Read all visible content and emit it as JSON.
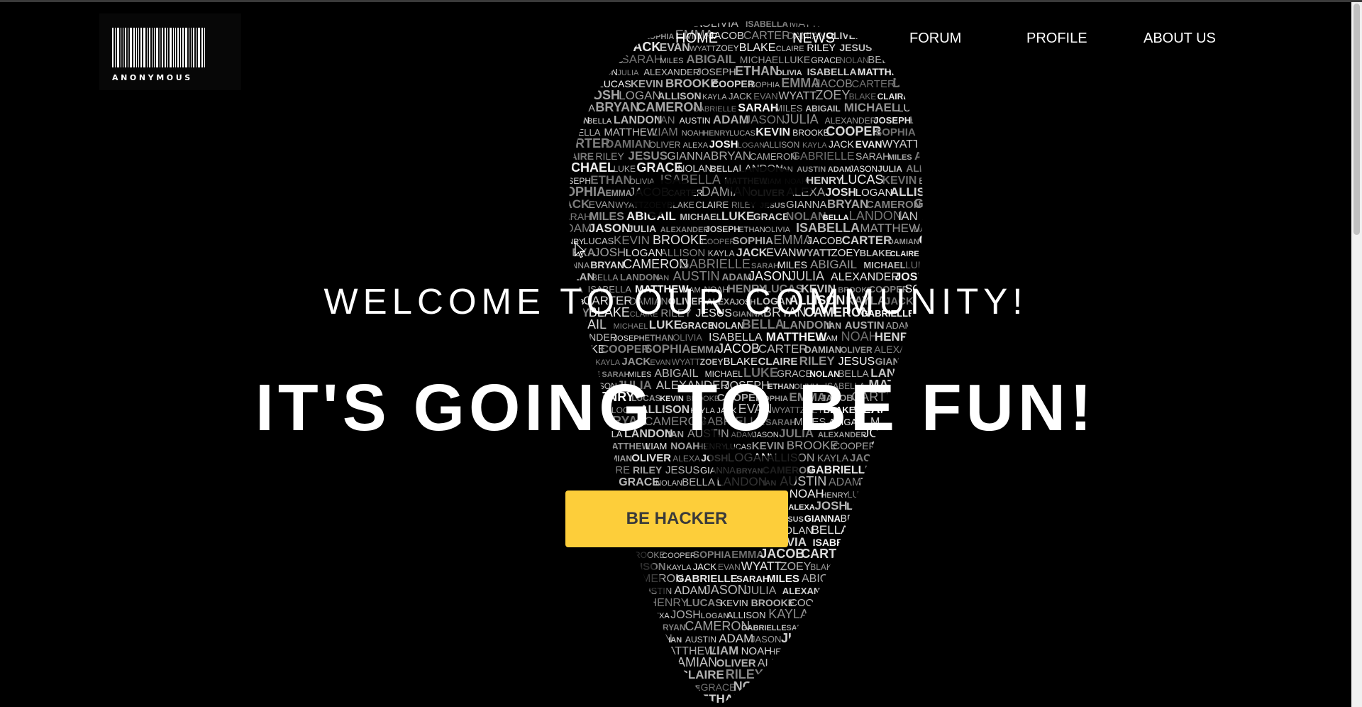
{
  "logo": {
    "text": "ANONYMOUS",
    "icon": "barcode-icon"
  },
  "nav": {
    "items": [
      {
        "label": "HOME"
      },
      {
        "label": "NEWS"
      },
      {
        "label": "FORUM"
      },
      {
        "label": "PROFILE"
      },
      {
        "label": "ABOUT US"
      }
    ]
  },
  "hero": {
    "subtitle": "WELCOME TO OUR COMMUNITY!",
    "title": "IT'S GOING TO BE FUN!",
    "cta_label": "BE HACKER"
  },
  "colors": {
    "background": "#000000",
    "text": "#ffffff",
    "cta_background": "#fdce3a",
    "cta_text": "#3a3a3a"
  },
  "background_art": {
    "icon": "guy-fawkes-mask-icon",
    "words": [
      "JULIA",
      "ALEXANDER",
      "JOSEPH",
      "ETHAN",
      "OLIVIA",
      "ISABELLA",
      "MATTHEW",
      "LIAM",
      "NOAH",
      "HENRY",
      "LUCAS",
      "KEVIN",
      "BROOKE",
      "COOPER",
      "SOPHIA",
      "EMMA",
      "JACOB",
      "CARTER",
      "DAMIAN",
      "OLIVER",
      "ALEXA",
      "JOSH",
      "LOGAN",
      "ALLISON",
      "KAYLA",
      "JACK",
      "EVAN",
      "WYATT",
      "ZOEY",
      "BLAKE",
      "CLAIRE",
      "RILEY",
      "JESUS",
      "GIANNA",
      "BRYAN",
      "CAMERON",
      "GABRIELLE",
      "SARAH",
      "MILES",
      "ABIGAIL",
      "MICHAEL",
      "LUKE",
      "GRACE",
      "NOLAN",
      "BELLA",
      "LANDON",
      "IAN",
      "AUSTIN",
      "ADAM",
      "JASON"
    ]
  }
}
